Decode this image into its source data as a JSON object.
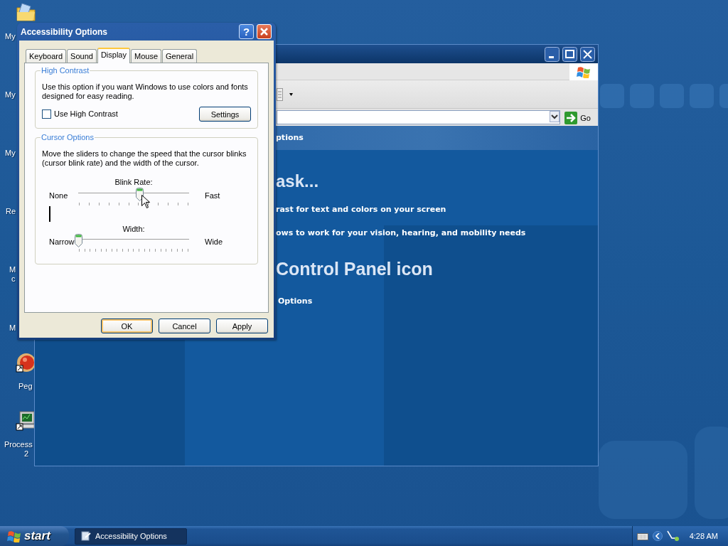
{
  "desktop_icons": [
    {
      "lines": [
        "My"
      ],
      "kind": "folder"
    },
    {
      "lines": [
        "My"
      ]
    },
    {
      "lines": [
        "My"
      ]
    },
    {
      "lines": [
        "Re"
      ]
    },
    {
      "lines": [
        "M",
        "c"
      ]
    },
    {
      "lines": [
        "M"
      ]
    },
    {
      "lines": [
        "Peg"
      ],
      "kind": "ball"
    },
    {
      "lines": [
        "Process",
        "2"
      ],
      "kind": "monitor"
    }
  ],
  "explorer_window": {
    "go_label": "Go",
    "header": "ptions",
    "heading_1": "ask...",
    "tasks": [
      "rast for text and colors on your screen",
      "ows to work for your vision, hearing, and mobility needs"
    ],
    "heading_2": "Control Panel icon",
    "icons": [
      "Options"
    ]
  },
  "dialog": {
    "title": "Accessibility Options",
    "help_glyph": "?",
    "tabs": [
      {
        "label": "Keyboard",
        "selected": false
      },
      {
        "label": "Sound",
        "selected": false
      },
      {
        "label": "Display",
        "selected": true
      },
      {
        "label": "Mouse",
        "selected": false
      },
      {
        "label": "General",
        "selected": false
      }
    ],
    "high_contrast": {
      "legend": "High Contrast",
      "description": "Use this option if you want Windows to use colors and fonts designed for easy reading.",
      "checkbox": {
        "label": "Use High Contrast",
        "checked": false
      },
      "button": "Settings"
    },
    "cursor_options": {
      "legend": "Cursor Options",
      "description": "Move the sliders to change the speed that the cursor blinks (cursor blink rate) and the width of the cursor.",
      "sliders": [
        {
          "kind": "blink",
          "label": "Blink Rate:",
          "min_label": "None",
          "max_label": "Fast",
          "level": 0.55
        },
        {
          "kind": "width",
          "label": "Width:",
          "min_label": "Narrow",
          "max_label": "Wide",
          "level": 0
        }
      ]
    },
    "buttons": [
      {
        "label": "OK",
        "default": true
      },
      {
        "label": "Cancel",
        "default": false
      },
      {
        "label": "Apply",
        "default": false
      }
    ]
  },
  "taskbar": {
    "start": "start",
    "tasks": [
      {
        "label": "Accessibility Options",
        "selected": true
      }
    ],
    "clock": "4:28 AM"
  }
}
